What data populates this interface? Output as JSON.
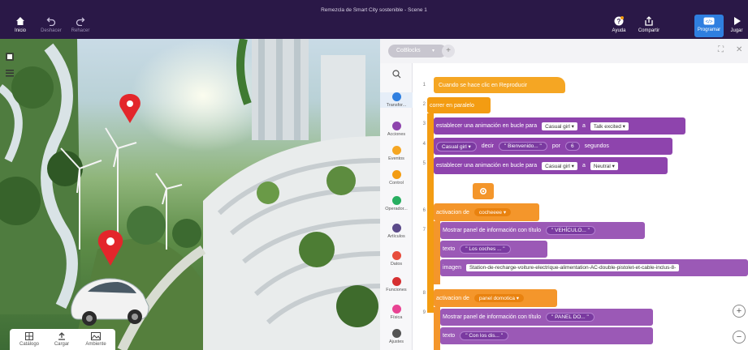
{
  "topbar": {
    "title": "Remezcla de Smart City sostenible - Scene 1",
    "home_label": "Inicio",
    "undo_label": "Deshacer",
    "redo_label": "Rehacer",
    "help_label": "Ayuda",
    "share_label": "Compartir",
    "program_label": "Programar",
    "play_label": "Jugar"
  },
  "scene": {
    "bottom_bar": {
      "catalog_label": "Catálogo",
      "upload_label": "Cargar",
      "environment_label": "Ambiente"
    }
  },
  "code": {
    "tab_label": "CoBlocks",
    "categories": [
      {
        "label": "Transfor...",
        "color": "#2f7fe0"
      },
      {
        "label": "Acciones",
        "color": "#8e44ad"
      },
      {
        "label": "Eventos",
        "color": "#f5a623"
      },
      {
        "label": "Control",
        "color": "#f39c12"
      },
      {
        "label": "Operador...",
        "color": "#27ae60"
      },
      {
        "label": "Artículos",
        "color": "#5b4a8a"
      },
      {
        "label": "Datos",
        "color": "#e74c3c"
      },
      {
        "label": "Funciones",
        "color": "#d63031"
      },
      {
        "label": "Física",
        "color": "#e84393"
      },
      {
        "label": "Ajustes",
        "color": "#555555"
      }
    ],
    "line_numbers": [
      "1",
      "2",
      "3",
      "4",
      "5",
      "6",
      "7",
      "8",
      "9"
    ],
    "blocks": {
      "b1": "Cuando se hace clic en Reproducir",
      "b2": "correr en paralelo",
      "b3_text": "establecer una animación en bucle para",
      "b3_obj": "Casual girl",
      "b3_a": "a",
      "b3_anim": "Talk excited",
      "b4_obj": "Casual girl",
      "b4_say": "decir",
      "b4_msg": "Bienvenido...",
      "b4_por": "por",
      "b4_num": "6",
      "b4_sec": "segundos",
      "b5_text": "establecer una animación en bucle para",
      "b5_obj": "Casual girl",
      "b5_a": "a",
      "b5_anim": "Neutral",
      "b6_text": "activacion de",
      "b6_obj": "cocheeee",
      "b7_text": "Mostrar panel de información con título",
      "b7_title": "VEHÍCULO...",
      "b7_texto": "texto",
      "b7_texto_val": "Los coches ...",
      "b7_imagen": "imagen",
      "b7_imagen_val": "Station-de-recharge-voiture-electrique-alimentation-AC-double-pistolet-et-cable-inclus-8-",
      "b8_text": "activacion de",
      "b8_obj": "panel domotica",
      "b9_text": "Mostrar panel de información con título",
      "b9_title": "PANEL DO...",
      "b9_texto": "texto",
      "b9_texto_val": "Con los dis..."
    },
    "zoom_in": "+",
    "zoom_out": "−"
  }
}
